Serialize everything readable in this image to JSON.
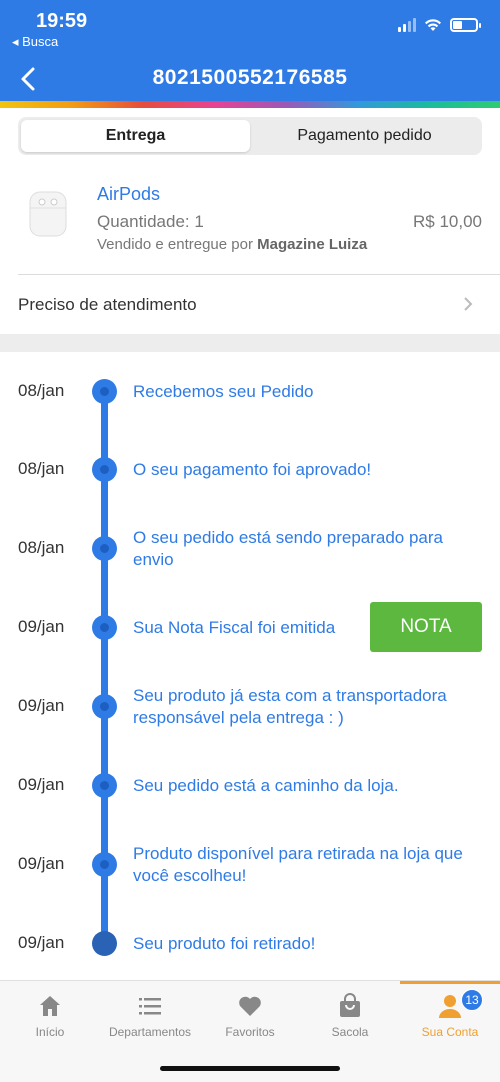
{
  "status_bar": {
    "time": "19:59",
    "back_app": "◂ Busca"
  },
  "header": {
    "title": "8021500552176585"
  },
  "tabs": [
    {
      "label": "Entrega",
      "active": true
    },
    {
      "label": "Pagamento pedido",
      "active": false
    }
  ],
  "product": {
    "name": "AirPods",
    "quantity": "Quantidade: 1",
    "price": "R$ 10,00",
    "seller_prefix": "Vendido e entregue por",
    "seller_name": "Magazine Luiza"
  },
  "help": {
    "label": "Preciso de atendimento"
  },
  "timeline": [
    {
      "date": "08/jan",
      "text": "Recebemos seu Pedido"
    },
    {
      "date": "08/jan",
      "text": "O seu pagamento foi aprovado!"
    },
    {
      "date": "08/jan",
      "text": "O seu pedido está sendo preparado para envio"
    },
    {
      "date": "09/jan",
      "text": "Sua Nota Fiscal foi emitida"
    },
    {
      "date": "09/jan",
      "text": "Seu produto já esta com a transportadora responsável pela entrega : )"
    },
    {
      "date": "09/jan",
      "text": "Seu pedido está a caminho da loja."
    },
    {
      "date": "09/jan",
      "text": "Produto disponível para retirada na loja que você escolheu!"
    },
    {
      "date": "09/jan",
      "text": "Seu produto foi retirado!"
    }
  ],
  "nota_button": "NOTA",
  "bottom_nav": [
    {
      "label": "Início",
      "icon": "home-icon"
    },
    {
      "label": "Departamentos",
      "icon": "list-icon"
    },
    {
      "label": "Favoritos",
      "icon": "heart-icon"
    },
    {
      "label": "Sacola",
      "icon": "bag-icon"
    },
    {
      "label": "Sua Conta",
      "icon": "user-icon",
      "active": true,
      "badge": "13"
    }
  ],
  "colors": {
    "primary": "#2f7be6",
    "accent": "#f0a030",
    "success": "#5cb83f"
  }
}
